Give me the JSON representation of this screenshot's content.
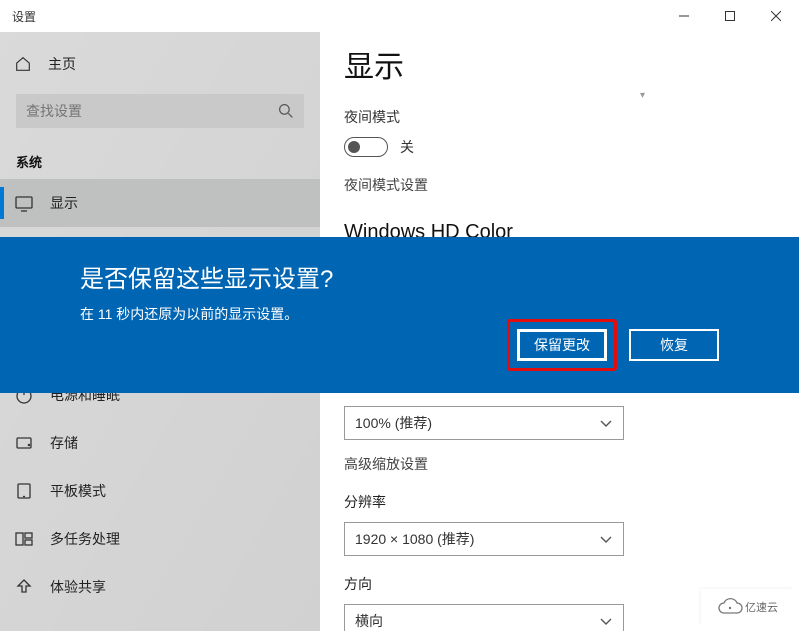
{
  "window": {
    "title": "设置"
  },
  "sidebar": {
    "home": "主页",
    "search_placeholder": "查找设置",
    "section": "系统",
    "items": [
      {
        "label": "显示"
      },
      {
        "label": "电源和睡眠"
      },
      {
        "label": "存储"
      },
      {
        "label": "平板模式"
      },
      {
        "label": "多任务处理"
      },
      {
        "label": "体验共享"
      }
    ]
  },
  "content": {
    "page_title": "显示",
    "night_label": "夜间模式",
    "night_state": "关",
    "night_settings": "夜间模式设置",
    "hd_heading": "Windows HD Color",
    "scale_value": "100% (推荐)",
    "advanced_scale": "高级缩放设置",
    "resolution_label": "分辨率",
    "resolution_value": "1920 × 1080 (推荐)",
    "orientation_label": "方向",
    "orientation_value": "横向"
  },
  "dialog": {
    "title": "是否保留这些显示设置?",
    "body": "在 11 秒内还原为以前的显示设置。",
    "keep": "保留更改",
    "revert": "恢复"
  },
  "watermark": "亿速云"
}
